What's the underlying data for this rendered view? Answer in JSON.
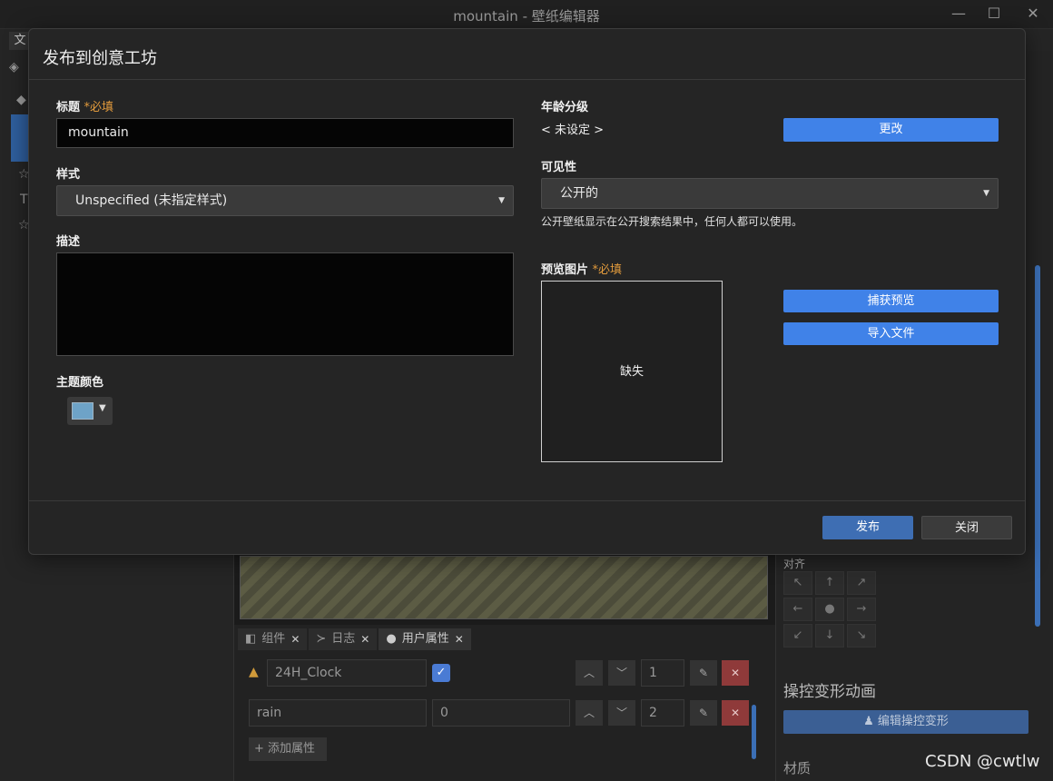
{
  "window": {
    "title": "mountain - 壁纸编辑器",
    "menu_file": "文",
    "min": "—",
    "max": "☐",
    "close": "✕"
  },
  "dialog": {
    "title": "发布到创意工坊",
    "title_field": {
      "label": "标题",
      "required": "*必填",
      "value": "mountain"
    },
    "style_field": {
      "label": "样式",
      "selected": "Unspecified (未指定样式)"
    },
    "description_field": {
      "label": "描述",
      "value": ""
    },
    "theme_color": {
      "label": "主题颜色",
      "color": "#6ea3c7"
    },
    "age_rating": {
      "label": "年龄分级",
      "value": "< 未设定 >",
      "change_button": "更改"
    },
    "visibility": {
      "label": "可见性",
      "selected": "公开的",
      "description": "公开壁纸显示在公开搜索结果中，任何人都可以使用。"
    },
    "preview": {
      "label": "预览图片",
      "required": "*必填",
      "missing_text": "缺失",
      "capture_button": "捕获预览",
      "import_button": "导入文件"
    },
    "publish_button": "发布",
    "close_button": "关闭"
  },
  "bottom_panel": {
    "tabs": [
      {
        "icon": "component-icon",
        "label": "组件"
      },
      {
        "icon": "terminal-icon",
        "label": "日志"
      },
      {
        "icon": "user-icon",
        "label": "用户属性"
      }
    ],
    "properties": [
      {
        "name": "24H_Clock",
        "checked": true,
        "order": "1",
        "warning": true
      },
      {
        "name": "rain",
        "value": "0",
        "order": "2",
        "warning": false
      }
    ],
    "add_property": "添加属性"
  },
  "right_panel": {
    "align_label": "对齐",
    "warp_title": "操控变形动画",
    "warp_button": "编辑操控变形",
    "material_title": "材质"
  },
  "watermark": "CSDN @cwtlw"
}
